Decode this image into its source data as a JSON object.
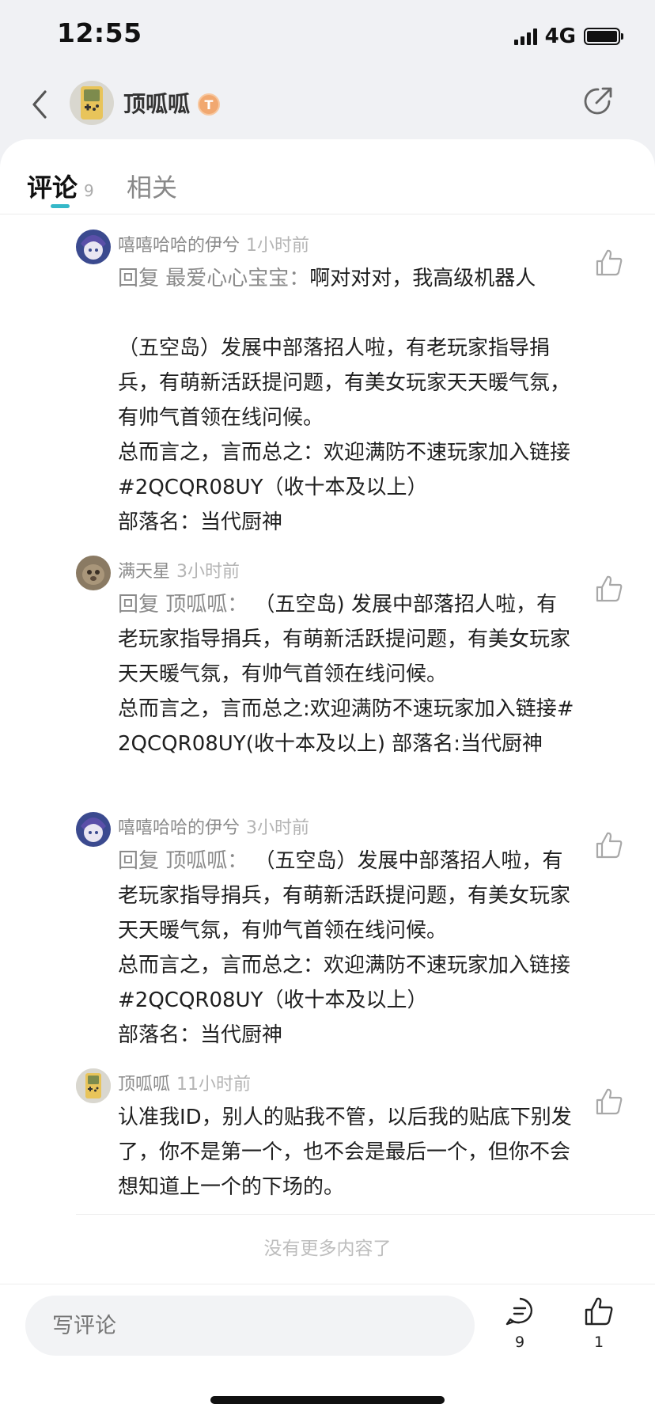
{
  "status_bar": {
    "time": "12:55",
    "network": "4G"
  },
  "nav": {
    "title": "顶呱呱",
    "rank_badge": "T",
    "icons": [
      "back-icon",
      "share-icon"
    ]
  },
  "tabs": [
    {
      "label": "评论",
      "count": "9",
      "active": true
    },
    {
      "label": "相关",
      "active": false
    }
  ],
  "comments": [
    {
      "author": "嘻嘻哈哈的伊兮",
      "time": "1小时前",
      "reply_prefix": "回复",
      "reply_target": "最爱心心宝宝：",
      "text": "啊对对对，我高级机器人\n\n（五空岛）发展中部落招人啦，有老玩家指导捐兵，有萌新活跃提问题，有美女玩家天天暖气氛，有帅气首领在线问候。\n总而言之，言而总之：欢迎满防不速玩家加入链接#2QCQR08UY（收十本及以上）\n部落名：当代厨神"
    },
    {
      "author": "满天星",
      "time": "3小时前",
      "reply_prefix": "回复",
      "reply_target": "顶呱呱：",
      "text": " （五空岛) 发展中部落招人啦，有老玩家指导捐兵，有萌新活跃提问题，有美女玩家天天暖气氛，有帅气首领在线问候。\n总而言之，言而总之:欢迎满防不速玩家加入链接#2QCQR08UY(收十本及以上) 部落名:当代厨神"
    },
    {
      "author": "嘻嘻哈哈的伊兮",
      "time": "3小时前",
      "reply_prefix": "回复",
      "reply_target": "顶呱呱：",
      "text": " （五空岛）发展中部落招人啦，有老玩家指导捐兵，有萌新活跃提问题，有美女玩家天天暖气氛，有帅气首领在线问候。\n总而言之，言而总之：欢迎满防不速玩家加入链接#2QCQR08UY（收十本及以上）\n部落名：当代厨神"
    },
    {
      "author": "顶呱呱",
      "time": "11小时前",
      "text": "认准我ID，别人的贴我不管，以后我的贴底下别发了，你不是第一个，也不会是最后一个，但你不会想知道上一个的下场的。"
    }
  ],
  "footer_note": "没有更多内容了",
  "bottom_bar": {
    "input_placeholder": "写评论",
    "comment_count": "9",
    "like_count": "1"
  },
  "colors": {
    "accent": "#35b8c8",
    "badge": "#f1a870"
  }
}
